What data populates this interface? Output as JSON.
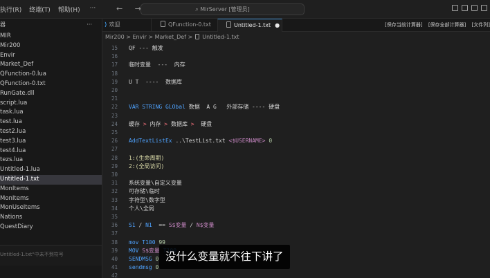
{
  "titlebar": {
    "menu": [
      "执行(R)",
      "终端(T)",
      "帮助(H)"
    ],
    "menu_more": "···",
    "back": "←",
    "forward": "→",
    "search": "⌕ MirServer [管理员]"
  },
  "tabs": {
    "welcome": "欢迎",
    "qf": "QFunction-0.txt",
    "active": "Untitled-1.txt",
    "dirty_dot": "●",
    "actions": [
      "[保存当前计算器]",
      "[保存全部计算器]",
      "[文件列]"
    ]
  },
  "sidebar": {
    "header": "器",
    "dots": "···",
    "items": [
      {
        "label": "MIR",
        "selected": false
      },
      {
        "label": "Mir200",
        "selected": false
      },
      {
        "label": "Envir",
        "selected": false
      },
      {
        "label": "Market_Def",
        "selected": false
      },
      {
        "label": "QFunction-0.lua",
        "selected": false
      },
      {
        "label": "QFunction-0.txt",
        "selected": false
      },
      {
        "label": "RunGate.dll",
        "selected": false
      },
      {
        "label": "script.lua",
        "selected": false
      },
      {
        "label": "task.lua",
        "selected": false
      },
      {
        "label": "test.lua",
        "selected": false
      },
      {
        "label": "test2.lua",
        "selected": false
      },
      {
        "label": "test3.lua",
        "selected": false
      },
      {
        "label": "test4.lua",
        "selected": false
      },
      {
        "label": "tezs.lua",
        "selected": false
      },
      {
        "label": "Untitled-1.lua",
        "selected": false
      },
      {
        "label": "Untitled-1.txt",
        "selected": true
      },
      {
        "label": "MonItems",
        "selected": false
      },
      {
        "label": "MonItems",
        "selected": false
      },
      {
        "label": "MonUseItems",
        "selected": false
      },
      {
        "label": "Nations",
        "selected": false
      },
      {
        "label": "QuestDiary",
        "selected": false
      }
    ],
    "footer": "Untitled-1.txt\"中未不到符号"
  },
  "breadcrumb": {
    "path": "Mir200 > Envir > Market_Def >",
    "file": "Untitled-1.txt"
  },
  "editor": {
    "lines": [
      {
        "n": "15",
        "segs": [
          {
            "t": "QF --- 触发",
            "c": "default"
          }
        ]
      },
      {
        "n": "16",
        "segs": []
      },
      {
        "n": "17",
        "segs": [
          {
            "t": "临时变量  ---  内存",
            "c": "default"
          }
        ]
      },
      {
        "n": "18",
        "segs": []
      },
      {
        "n": "19",
        "segs": [
          {
            "t": "U T  ----  数据库",
            "c": "default"
          }
        ]
      },
      {
        "n": "20",
        "segs": []
      },
      {
        "n": "21",
        "segs": []
      },
      {
        "n": "22",
        "segs": [
          {
            "t": "VAR STRING GLObal",
            "c": "blue"
          },
          {
            "t": " 数据  A G   外部存储 ---- 硬盘",
            "c": "default"
          }
        ]
      },
      {
        "n": "23",
        "segs": []
      },
      {
        "n": "24",
        "segs": [
          {
            "t": "缓存 ",
            "c": "default"
          },
          {
            "t": ">",
            "c": "red"
          },
          {
            "t": " 内存 ",
            "c": "default"
          },
          {
            "t": ">",
            "c": "red"
          },
          {
            "t": " 数据库 ",
            "c": "default"
          },
          {
            "t": ">",
            "c": "red"
          },
          {
            "t": "  硬盘",
            "c": "default"
          }
        ]
      },
      {
        "n": "25",
        "segs": []
      },
      {
        "n": "26",
        "segs": [
          {
            "t": "AddTextListEx",
            "c": "blue"
          },
          {
            "t": " ..\\TestList.txt ",
            "c": "default"
          },
          {
            "t": "<$USERNAME>",
            "c": "purple"
          },
          {
            "t": " 0",
            "c": "green"
          }
        ]
      },
      {
        "n": "27",
        "segs": []
      },
      {
        "n": "28",
        "segs": [
          {
            "t": "1:(生命周期)",
            "c": "yellow"
          }
        ]
      },
      {
        "n": "29",
        "segs": [
          {
            "t": "2:(全局访问)",
            "c": "yellow"
          }
        ]
      },
      {
        "n": "30",
        "segs": []
      },
      {
        "n": "31",
        "segs": [
          {
            "t": "系统变量\\自定义变量",
            "c": "default"
          }
        ]
      },
      {
        "n": "32",
        "segs": [
          {
            "t": "可存储\\临时",
            "c": "default"
          }
        ]
      },
      {
        "n": "33",
        "segs": [
          {
            "t": "字符型\\数字型",
            "c": "default"
          }
        ]
      },
      {
        "n": "34",
        "segs": [
          {
            "t": "个人\\全局",
            "c": "default"
          }
        ]
      },
      {
        "n": "35",
        "segs": []
      },
      {
        "n": "36",
        "segs": [
          {
            "t": "S1",
            "c": "blue"
          },
          {
            "t": " / ",
            "c": "default"
          },
          {
            "t": "N1",
            "c": "blue"
          },
          {
            "t": "  == ",
            "c": "default"
          },
          {
            "t": "S$变量",
            "c": "purple"
          },
          {
            "t": " / ",
            "c": "default"
          },
          {
            "t": "N$变量",
            "c": "purple"
          }
        ]
      },
      {
        "n": "37",
        "segs": []
      },
      {
        "n": "38",
        "segs": [
          {
            "t": "mov",
            "c": "blue"
          },
          {
            "t": " ",
            "c": "default"
          },
          {
            "t": "T100",
            "c": "blue"
          },
          {
            "t": " 99",
            "c": "green"
          }
        ]
      },
      {
        "n": "39",
        "segs": [
          {
            "t": "MOV",
            "c": "blue"
          },
          {
            "t": " ",
            "c": "default"
          },
          {
            "t": "S$变量",
            "c": "purple"
          },
          {
            "t": " ",
            "c": "default"
          },
          {
            "t": "T100",
            "c": "blue"
          }
        ]
      },
      {
        "n": "40",
        "segs": [
          {
            "t": "SENDMSG",
            "c": "blue"
          },
          {
            "t": " 0",
            "c": "green"
          }
        ]
      },
      {
        "n": "41",
        "segs": [
          {
            "t": "sendmsg",
            "c": "blue"
          },
          {
            "t": " 0",
            "c": "green"
          }
        ]
      },
      {
        "n": "42",
        "segs": []
      },
      {
        "n": "43",
        "segs": []
      }
    ]
  },
  "subtitle": "没什么变量就不往下讲了",
  "colors": {
    "accent": "#3c8fd6",
    "keyword_blue": "#4fa3ff",
    "variable_purple": "#c586c0",
    "operator_red": "#f1707a"
  }
}
